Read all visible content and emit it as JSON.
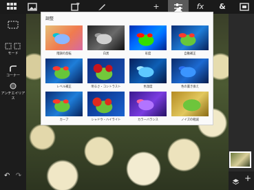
{
  "toolbar": {
    "icons": [
      "back-to-gallery-icon",
      "image-icon",
      "rotate-icon",
      "brush-icon",
      "add-icon",
      "adjustments-icon",
      "fx-icon",
      "ampersand-icon",
      "fullscreen-icon"
    ],
    "fx_label": "fx",
    "ampersand_label": "&",
    "plus_label": "+"
  },
  "left_tools": {
    "mode_label": "モード",
    "corner_label": "コーナー",
    "antialias_label": "アンチエイリアス",
    "undo_symbol": "↶",
    "redo_symbol": "↷"
  },
  "adjust_panel": {
    "title": "調整",
    "items": [
      {
        "label": "階調の反転",
        "key": "invert"
      },
      {
        "label": "白黒",
        "key": "bw"
      },
      {
        "label": "彩度",
        "key": "saturation"
      },
      {
        "label": "自動補正",
        "key": "auto"
      },
      {
        "label": "レベル補正",
        "key": "levels"
      },
      {
        "label": "明るさ・コントラスト",
        "key": "brightness"
      },
      {
        "label": "色温度",
        "key": "temperature"
      },
      {
        "label": "色の置き換え",
        "key": "replace"
      },
      {
        "label": "カーブ",
        "key": "curves"
      },
      {
        "label": "シャドウ・ハイライト",
        "key": "shadows"
      },
      {
        "label": "カラーバランス",
        "key": "balance"
      },
      {
        "label": "ノイズの軽減",
        "key": "noise"
      }
    ]
  },
  "layers": {
    "add_label": "+"
  }
}
